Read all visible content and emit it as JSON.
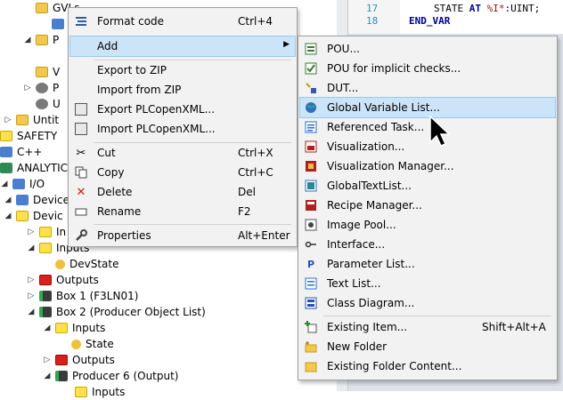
{
  "tree": {
    "rows": [
      {
        "label": "GVLs",
        "icon": "folder-icon"
      },
      {
        "label": "P",
        "icon": "folder-icon"
      },
      {
        "label": "V",
        "icon": "folder-icon"
      },
      {
        "label": "P",
        "icon": "plc-icon"
      },
      {
        "label": "U",
        "icon": "plc-icon"
      },
      {
        "label": "Untit",
        "icon": "project-icon"
      },
      {
        "label": "SAFETY",
        "icon": "safety-icon"
      },
      {
        "label": "C++",
        "icon": "cpp-icon"
      },
      {
        "label": "ANALYTICS",
        "icon": "analytics-icon"
      },
      {
        "label": "I/O",
        "icon": "io-icon"
      },
      {
        "label": "Devices",
        "icon": "devices-icon"
      },
      {
        "label": "Devic",
        "icon": "device-icon"
      },
      {
        "label": "In",
        "icon": "inputs-icon"
      },
      {
        "label": "Inputs",
        "icon": "inputs-icon"
      },
      {
        "label": "DevState",
        "icon": "variable-icon"
      },
      {
        "label": "Outputs",
        "icon": "outputs-icon"
      },
      {
        "label": "Box 1 (F3LN01)",
        "icon": "box-icon"
      },
      {
        "label": "Box 2 (Producer Object List)",
        "icon": "box-icon"
      },
      {
        "label": "Inputs",
        "icon": "inputs-icon"
      },
      {
        "label": "State",
        "icon": "variable-icon"
      },
      {
        "label": "Outputs",
        "icon": "outputs-icon"
      },
      {
        "label": "Producer 6 (Output)",
        "icon": "box-icon"
      },
      {
        "label": "Inputs",
        "icon": "inputs-icon"
      }
    ]
  },
  "editor": {
    "lines": [
      {
        "num": "17",
        "code_pre": "STATE ",
        "kw": "AT",
        "code_mid": " ",
        "lit": "%I*",
        "code_post": ":UINT;"
      },
      {
        "num": "18",
        "code_pre": "",
        "kw": "END_VAR",
        "code_mid": "",
        "lit": "",
        "code_post": ""
      }
    ]
  },
  "context_menu": {
    "items": [
      {
        "label": "Format code",
        "shortcut": "Ctrl+4",
        "icon": "format-code-icon"
      },
      {
        "label": "Add",
        "shortcut": "",
        "icon": "",
        "submenu": true
      },
      {
        "label": "Export to ZIP",
        "shortcut": "",
        "icon": ""
      },
      {
        "label": "Import from ZIP",
        "shortcut": "",
        "icon": ""
      },
      {
        "label": "Export PLCopenXML...",
        "shortcut": "",
        "icon": "export-xml-icon"
      },
      {
        "label": "Import PLCopenXML...",
        "shortcut": "",
        "icon": "import-xml-icon"
      },
      {
        "label": "Cut",
        "shortcut": "Ctrl+X",
        "icon": "scissors-icon"
      },
      {
        "label": "Copy",
        "shortcut": "Ctrl+C",
        "icon": "copy-icon"
      },
      {
        "label": "Delete",
        "shortcut": "Del",
        "icon": "delete-icon"
      },
      {
        "label": "Rename",
        "shortcut": "F2",
        "icon": "rename-icon"
      },
      {
        "label": "Properties",
        "shortcut": "Alt+Enter",
        "icon": "wrench-icon"
      }
    ]
  },
  "add_submenu": {
    "items": [
      {
        "label": "POU...",
        "shortcut": "",
        "icon": "pou-icon"
      },
      {
        "label": "POU for implicit checks...",
        "shortcut": "",
        "icon": "pou-checks-icon"
      },
      {
        "label": "DUT...",
        "shortcut": "",
        "icon": "dut-icon"
      },
      {
        "label": "Global Variable List...",
        "shortcut": "",
        "icon": "globe-icon",
        "highlighted": true
      },
      {
        "label": "Referenced Task...",
        "shortcut": "",
        "icon": "task-icon"
      },
      {
        "label": "Visualization...",
        "shortcut": "",
        "icon": "visualization-icon"
      },
      {
        "label": "Visualization Manager...",
        "shortcut": "",
        "icon": "vis-manager-icon"
      },
      {
        "label": "GlobalTextList...",
        "shortcut": "",
        "icon": "text-list-icon"
      },
      {
        "label": "Recipe Manager...",
        "shortcut": "",
        "icon": "recipe-icon"
      },
      {
        "label": "Image Pool...",
        "shortcut": "",
        "icon": "image-pool-icon"
      },
      {
        "label": "Interface...",
        "shortcut": "",
        "icon": "interface-icon"
      },
      {
        "label": "Parameter List...",
        "shortcut": "",
        "icon": "parameter-icon"
      },
      {
        "label": "Text List...",
        "shortcut": "",
        "icon": "text-list-icon"
      },
      {
        "label": "Class Diagram...",
        "shortcut": "",
        "icon": "class-diagram-icon"
      },
      {
        "label": "Existing Item...",
        "shortcut": "Shift+Alt+A",
        "icon": "existing-item-icon"
      },
      {
        "label": "New Folder",
        "shortcut": "",
        "icon": "new-folder-icon"
      },
      {
        "label": "Existing Folder Content...",
        "shortcut": "",
        "icon": "folder-icon"
      }
    ]
  },
  "colors": {
    "highlight": "#cce4f7",
    "menu_bg": "#f2f2f2",
    "keyword": "#00008b",
    "line_number": "#2b91af"
  }
}
